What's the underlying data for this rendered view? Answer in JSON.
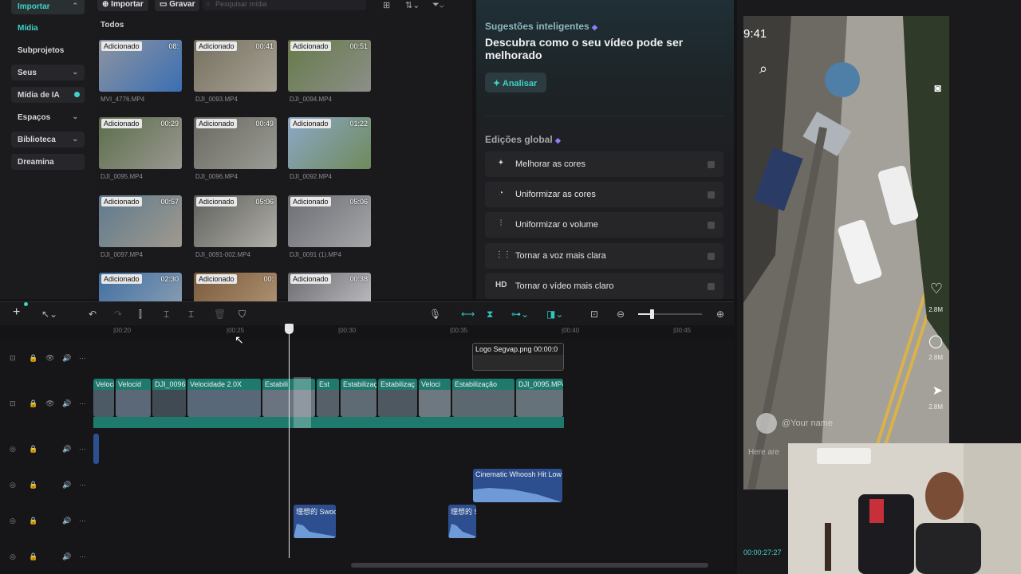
{
  "nav": {
    "items": [
      {
        "label": "Importar",
        "style": "active-head",
        "chev": "⌃"
      },
      {
        "label": "Mídia",
        "style": "sel",
        "chev": ""
      },
      {
        "label": "Subprojetos",
        "style": "",
        "chev": ""
      },
      {
        "label": "Seus",
        "style": "btn",
        "chev": "⌄"
      },
      {
        "label": "Mídia de IA",
        "style": "btn",
        "chev": ""
      },
      {
        "label": "Espaços",
        "style": "",
        "chev": "⌄"
      },
      {
        "label": "Biblioteca",
        "style": "btn",
        "chev": "⌄"
      },
      {
        "label": "Dreamina",
        "style": "btn",
        "chev": ""
      }
    ]
  },
  "media": {
    "import_label": "Importar",
    "record_label": "Gravar",
    "search_placeholder": "Pesquisar mídia",
    "section_title": "Todos",
    "badge_text": "Adicionado",
    "items": [
      {
        "name": "MVI_4776.MP4",
        "duration": "08:"
      },
      {
        "name": "DJI_0093.MP4",
        "duration": "00:41"
      },
      {
        "name": "DJI_0094.MP4",
        "duration": "00:51"
      },
      {
        "name": "DJI_0095.MP4",
        "duration": "00:29"
      },
      {
        "name": "DJI_0096.MP4",
        "duration": "00:49"
      },
      {
        "name": "DJI_0092.MP4",
        "duration": "01:22"
      },
      {
        "name": "DJI_0097.MP4",
        "duration": "00:57"
      },
      {
        "name": "DJI_0091-002.MP4",
        "duration": "05:06"
      },
      {
        "name": "DJI_0091 (1).MP4",
        "duration": "05:06"
      },
      {
        "name": "",
        "duration": "02:30"
      },
      {
        "name": "",
        "duration": "00:"
      },
      {
        "name": "",
        "duration": "00:38"
      }
    ]
  },
  "smart": {
    "suggestions_title": "Sugestões inteligentes",
    "headline": "Descubra como o seu vídeo pode ser melhorado",
    "analyze_label": "Analisar",
    "global_title": "Edições global",
    "options": [
      {
        "label": "Melhorar as cores",
        "icon": "✦"
      },
      {
        "label": "Uniformizar as cores",
        "icon": "◔"
      },
      {
        "label": "Uniformizar o volume",
        "icon": "⫶"
      },
      {
        "label": "Tornar a voz mais clara",
        "icon": "⋮⋮"
      },
      {
        "label": "Tornar o vídeo mais claro",
        "icon": "HD"
      }
    ]
  },
  "preview": {
    "status_time": "9:41",
    "username_placeholder": "@Your name",
    "caption_placeholder": "Here are",
    "counts": [
      "2.8M",
      "2.8M",
      "2.8M"
    ],
    "timecode": "00:00:27:27"
  },
  "timeline": {
    "ruler_ticks": [
      "00:20",
      "00:25",
      "00:30",
      "00:35",
      "00:40",
      "00:45"
    ],
    "overlay_clip": {
      "label": "Logo Segvap.png",
      "time": "00:00:0"
    },
    "main_clips": [
      "Veloci",
      "Velocid",
      "DJI_0096.I",
      "Velocidade 2.0X",
      "Estabili",
      "Est",
      "Estabilizaç",
      "Estabilizaç",
      "Veloci",
      "Estabilização",
      "DJI_0095.MP4"
    ],
    "audio_clips": [
      {
        "label": "Cinematic Whoosh Hit Low"
      },
      {
        "label": "理想的 Swoo"
      },
      {
        "label": "理想的 S"
      }
    ]
  },
  "colors": {
    "accent": "#3fd3c8",
    "clip_teal": "#1f7a6e",
    "audio_blue": "#3f64a8"
  }
}
